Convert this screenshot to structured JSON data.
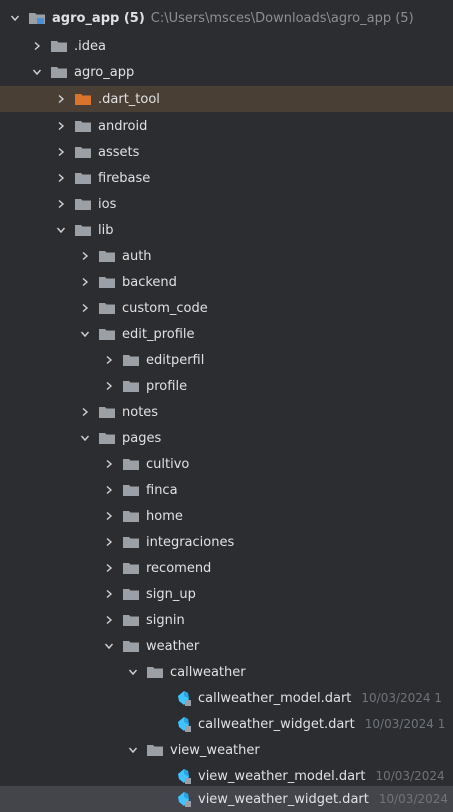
{
  "root": {
    "name": "agro_app (5)",
    "path": "C:\\Users\\msces\\Downloads\\agro_app (5)"
  },
  "items": {
    "idea": ".idea",
    "agro_app": "agro_app",
    "dart_tool": ".dart_tool",
    "android": "android",
    "assets": "assets",
    "firebase": "firebase",
    "ios": "ios",
    "lib": "lib",
    "auth": "auth",
    "backend": "backend",
    "custom_code": "custom_code",
    "edit_profile": "edit_profile",
    "editperfil": "editperfil",
    "profile": "profile",
    "notes": "notes",
    "pages": "pages",
    "cultivo": "cultivo",
    "finca": "finca",
    "home": "home",
    "integraciones": "integraciones",
    "recomend": "recomend",
    "sign_up": "sign_up",
    "signin": "signin",
    "weather": "weather",
    "callweather": "callweather",
    "callweather_model": "callweather_model.dart",
    "callweather_model_date": "10/03/2024 1",
    "callweather_widget": "callweather_widget.dart",
    "callweather_widget_date": "10/03/2024 1",
    "view_weather": "view_weather",
    "view_weather_model": "view_weather_model.dart",
    "view_weather_model_date": "10/03/2024",
    "view_weather_widget": "view_weather_widget.dart",
    "view_weather_widget_date": "10/03/2024"
  },
  "colors": {
    "folder": "#9aa0a6",
    "excluded_folder": "#d9752b",
    "module_folder": "#4c8ed9",
    "dart": "#40c4ff",
    "background": "#2b2d30",
    "selection": "#43454a"
  }
}
